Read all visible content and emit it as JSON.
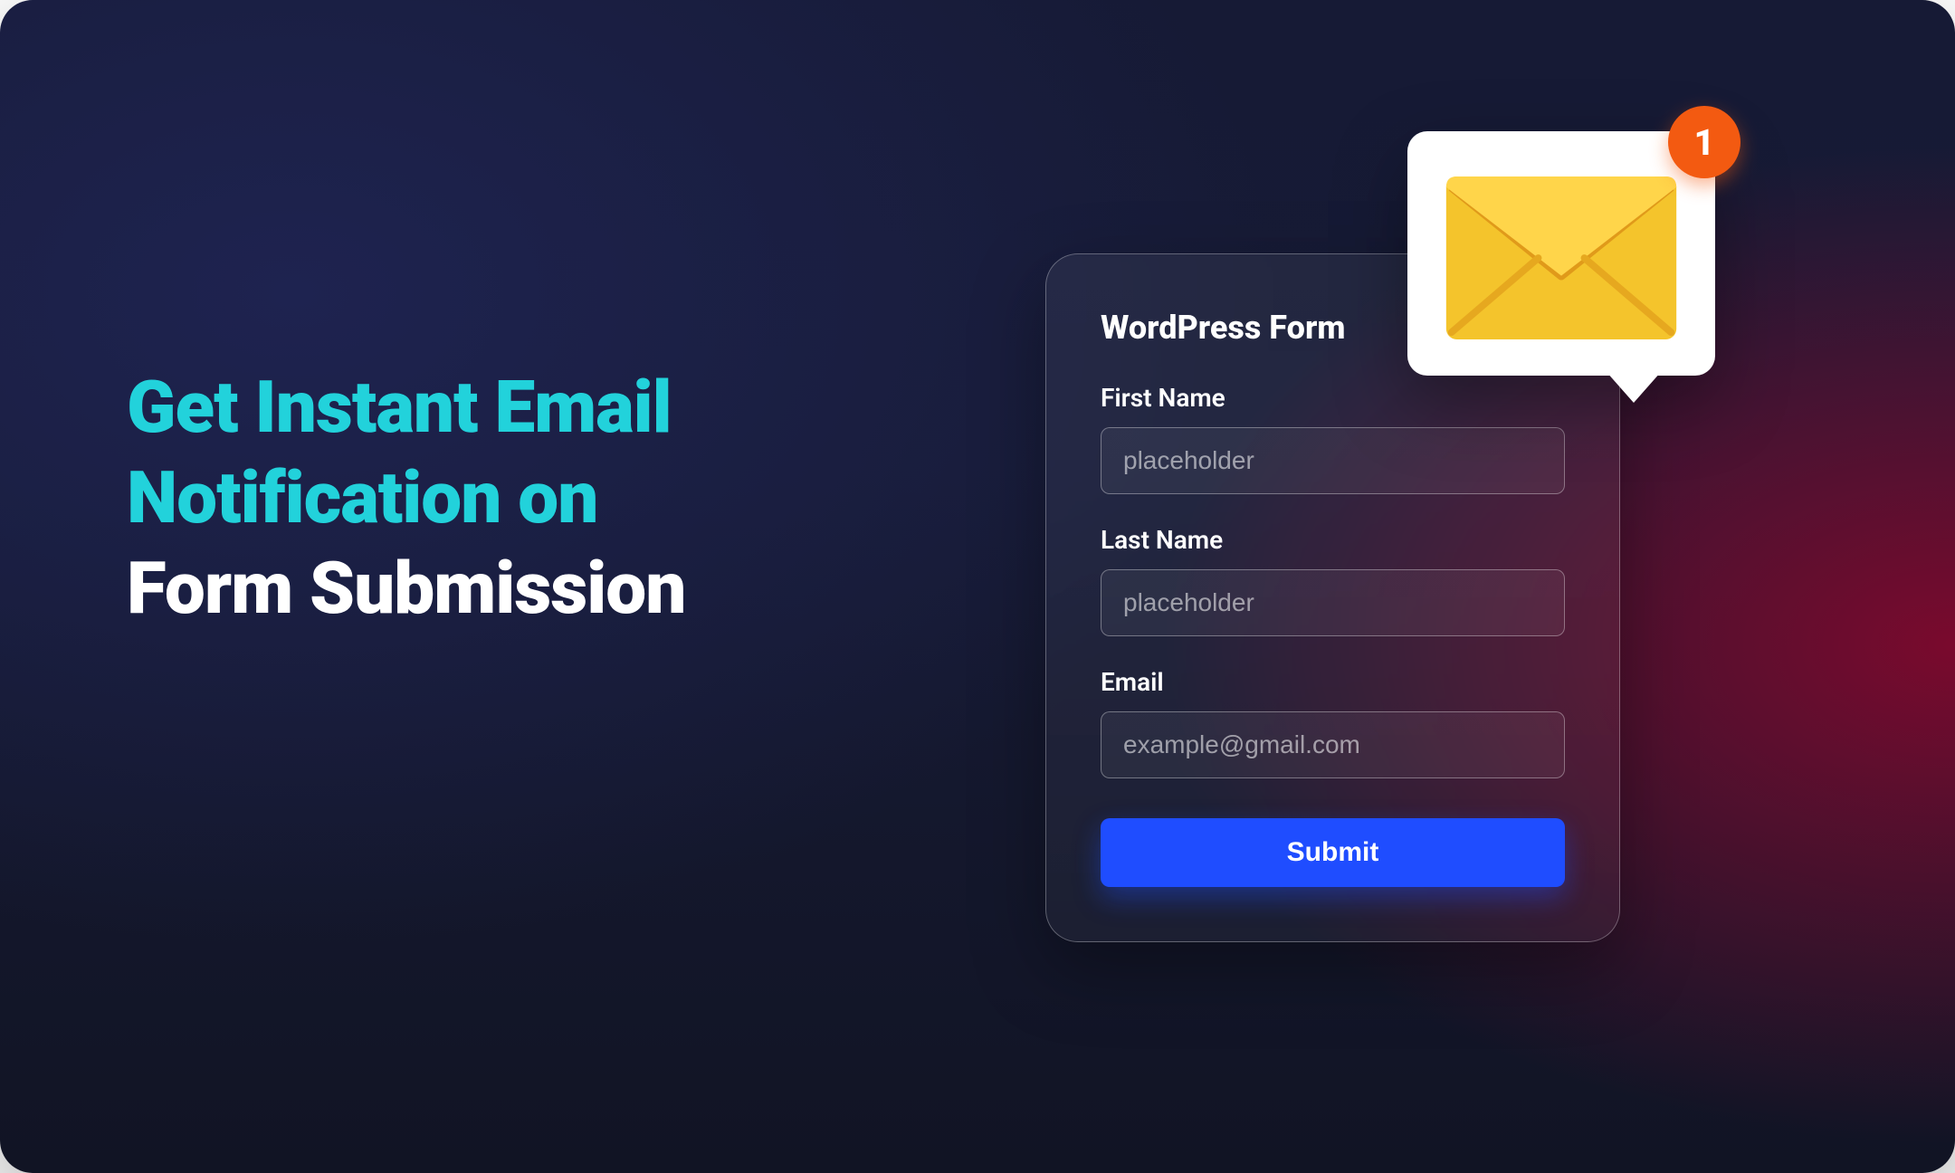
{
  "headline": {
    "line1": "Get Instant Email",
    "line2": "Notification on",
    "line3": "Form Submission"
  },
  "form": {
    "title": "WordPress Form",
    "fields": {
      "first_name": {
        "label": "First Name",
        "placeholder": "placeholder"
      },
      "last_name": {
        "label": "Last Name",
        "placeholder": "placeholder"
      },
      "email": {
        "label": "Email",
        "placeholder": "example@gmail.com"
      }
    },
    "submit_label": "Submit"
  },
  "notification": {
    "badge_count": "1"
  }
}
